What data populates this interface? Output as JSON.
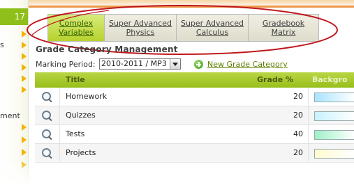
{
  "sidebar": {
    "header": "17",
    "fragments": [
      "s",
      "ment"
    ]
  },
  "tabs": [
    {
      "label": "Complex\nVariables",
      "active": true
    },
    {
      "label": "Super Advanced\nPhysics",
      "active": false
    },
    {
      "label": "Super Advanced\nCalculus",
      "active": false
    },
    {
      "label": "Gradebook\nMatrix",
      "active": false
    }
  ],
  "page": {
    "title": "Grade Category Management"
  },
  "marking_period": {
    "label": "Marking Period:",
    "value": "2010-2011 / MP3"
  },
  "new_category_link": "New Grade Category",
  "table": {
    "headers": {
      "title": "Title",
      "grade": "Grade %",
      "background": "Backgro"
    },
    "rows": [
      {
        "title": "Homework",
        "grade": "20",
        "color": "#a8e4ff"
      },
      {
        "title": "Quizzes",
        "grade": "20",
        "color": "#c8f2ff"
      },
      {
        "title": "Tests",
        "grade": "40",
        "color": "#9ff0c8"
      },
      {
        "title": "Projects",
        "grade": "20",
        "color": "#fffbd0"
      }
    ]
  },
  "colors": {
    "accent_green": "#9cc31f",
    "highlight_ellipse": "#c0161c",
    "sidebar_arrow": "#f0b400"
  }
}
